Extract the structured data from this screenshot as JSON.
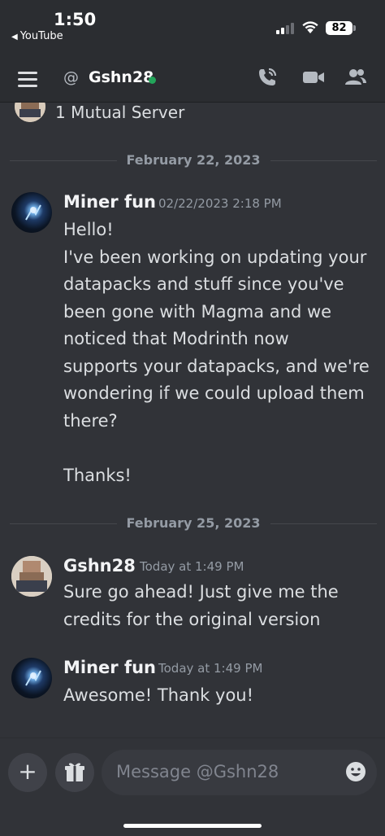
{
  "status": {
    "time": "1:50",
    "back_app": "YouTube",
    "battery": "82"
  },
  "header": {
    "at": "@",
    "channel": "Gshn28"
  },
  "mutual": {
    "text": "1 Mutual Server"
  },
  "dividers": [
    "February 22, 2023",
    "February 25, 2023"
  ],
  "messages": [
    {
      "author": "Miner fun",
      "timestamp": "02/22/2023 2:18 PM",
      "lines": [
        "Hello!",
        "I've been working on updating your",
        "datapacks and stuff since you've",
        "been gone with Magma and we",
        "noticed that Modrinth now",
        "supports your datapacks, and we're",
        "wondering if we could upload them",
        "there?",
        "",
        "Thanks!"
      ]
    },
    {
      "author": "Gshn28",
      "timestamp": "Today at 1:49 PM",
      "lines": [
        "Sure go ahead! Just give me the",
        "credits for the original version"
      ]
    },
    {
      "author": "Miner fun",
      "timestamp": "Today at 1:49 PM",
      "lines": [
        "Awesome! Thank you!"
      ]
    }
  ],
  "composer": {
    "placeholder": "Message @Gshn28"
  },
  "colors": {
    "background": "#313338",
    "header": "#2b2d31",
    "online": "#23a55a"
  },
  "icons": [
    "hamburger-icon",
    "at-icon",
    "phone-call-icon",
    "video-icon",
    "members-icon",
    "plus-icon",
    "gift-icon",
    "emoji-icon"
  ]
}
